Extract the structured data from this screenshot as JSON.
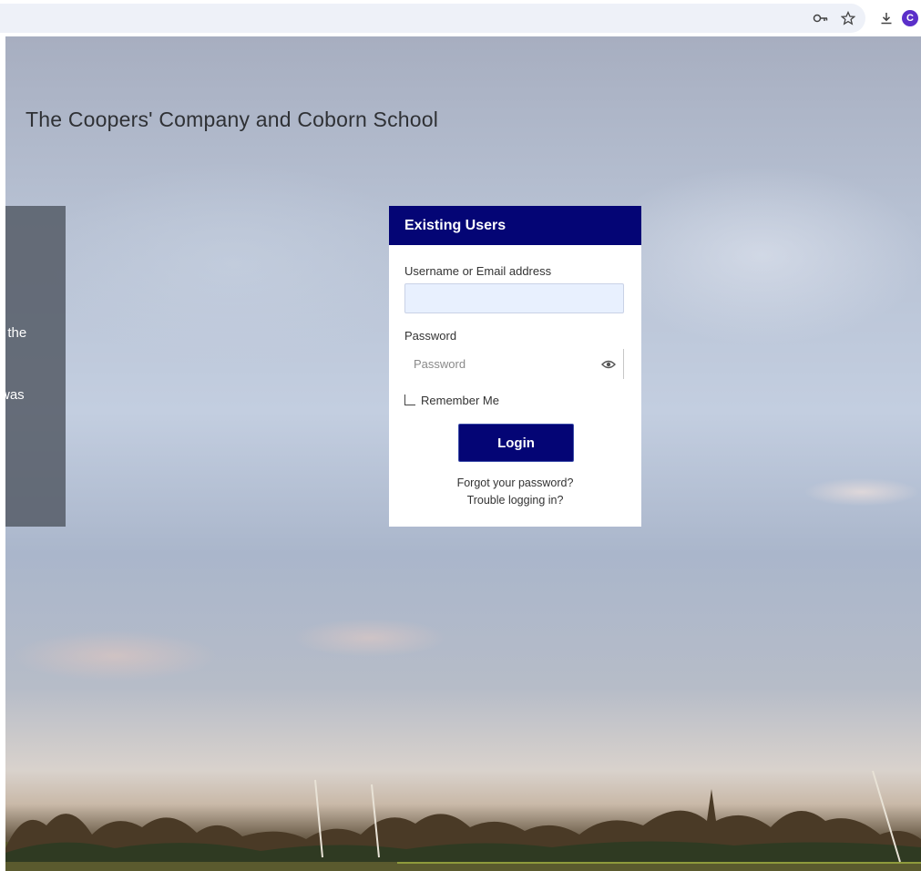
{
  "browser": {
    "icons": [
      "key-icon",
      "star-icon",
      "download-icon",
      "profile-icon"
    ],
    "profile_initial": "C",
    "profile_color": "#5b2fc9"
  },
  "page": {
    "school_title": "The Coopers' Company and Coborn School"
  },
  "info_panel": {
    "line_1": "t the",
    "line_2": "was"
  },
  "login": {
    "header": "Existing Users",
    "username_label": "Username or Email address",
    "username_value": "",
    "password_label": "Password",
    "password_placeholder": "Password",
    "remember_label": "Remember Me",
    "remember_checked": false,
    "login_button": "Login",
    "forgot_link": "Forgot your password?",
    "trouble_link": "Trouble logging in?"
  },
  "colors": {
    "header_bg": "#040575",
    "button_bg": "#040575",
    "input_autofill_bg": "#e8f0fe"
  }
}
